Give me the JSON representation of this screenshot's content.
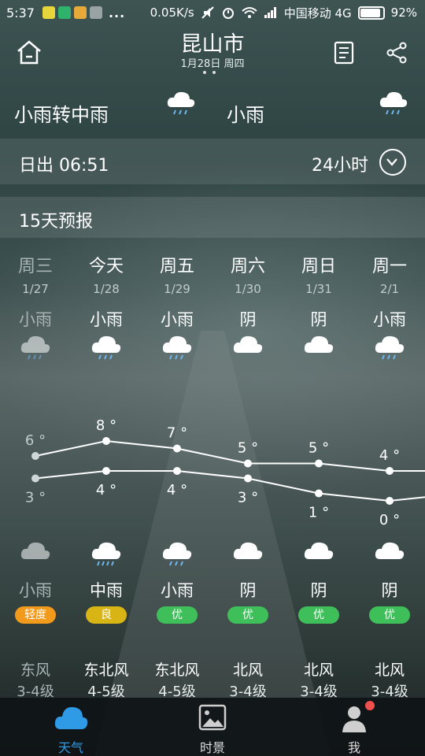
{
  "status": {
    "time": "5:37",
    "more": "...",
    "speed": "0.05K/s",
    "carrier": "中国移动 4G",
    "battery": "92%",
    "battery_level": 0.92
  },
  "header": {
    "city": "昆山市",
    "date": "1月28日 周四",
    "page_dots": 2
  },
  "summary": {
    "today_cond": "小雨转中雨",
    "tomorrow_cond": "小雨"
  },
  "sunrise": {
    "text": "日出 06:51",
    "hours": "24小时"
  },
  "forecast": {
    "title": "15天预报",
    "days": [
      {
        "weekday": "周三",
        "date": "1/27",
        "day_cond": "小雨",
        "day_icon": "rain-cloud-icon",
        "high": "6 °",
        "low": "3 °",
        "night_icon": "cloud-icon",
        "night_cond": "小雨",
        "aqi": "轻度",
        "aqi_color": "#f29a1b",
        "wind_dir": "东风",
        "wind_lvl": "3-4级",
        "past": true
      },
      {
        "weekday": "今天",
        "date": "1/28",
        "day_cond": "小雨",
        "day_icon": "rain-cloud-icon",
        "high": "8 °",
        "low": "4 °",
        "night_icon": "heavy-rain-cloud-icon",
        "night_cond": "中雨",
        "aqi": "良",
        "aqi_color": "#d8b414",
        "wind_dir": "东北风",
        "wind_lvl": "4-5级",
        "past": false
      },
      {
        "weekday": "周五",
        "date": "1/29",
        "day_cond": "小雨",
        "day_icon": "rain-cloud-icon",
        "high": "7 °",
        "low": "4 °",
        "night_icon": "rain-cloud-icon",
        "night_cond": "小雨",
        "aqi": "优",
        "aqi_color": "#3fbf5a",
        "wind_dir": "东北风",
        "wind_lvl": "4-5级",
        "past": false
      },
      {
        "weekday": "周六",
        "date": "1/30",
        "day_cond": "阴",
        "day_icon": "cloud-icon",
        "high": "5 °",
        "low": "3 °",
        "night_icon": "cloud-icon",
        "night_cond": "阴",
        "aqi": "优",
        "aqi_color": "#3fbf5a",
        "wind_dir": "北风",
        "wind_lvl": "3-4级",
        "past": false
      },
      {
        "weekday": "周日",
        "date": "1/31",
        "day_cond": "阴",
        "day_icon": "cloud-icon",
        "high": "5 °",
        "low": "1 °",
        "night_icon": "cloud-icon",
        "night_cond": "阴",
        "aqi": "优",
        "aqi_color": "#3fbf5a",
        "wind_dir": "北风",
        "wind_lvl": "3-4级",
        "past": false
      },
      {
        "weekday": "周一",
        "date": "2/1",
        "day_cond": "小雨",
        "day_icon": "rain-cloud-icon",
        "high": "4 °",
        "low": "0 °",
        "night_icon": "cloud-icon",
        "night_cond": "阴",
        "aqi": "优",
        "aqi_color": "#3fbf5a",
        "wind_dir": "北风",
        "wind_lvl": "3-4级",
        "past": false
      }
    ],
    "high_values": [
      6,
      8,
      7,
      5,
      5,
      4,
      4
    ],
    "low_values": [
      3,
      4,
      4,
      3,
      1,
      0,
      1
    ]
  },
  "nav": {
    "weather": "天气",
    "scene": "时景",
    "me": "我",
    "active_color": "#2f9be6",
    "badge_color": "#f0504d"
  }
}
